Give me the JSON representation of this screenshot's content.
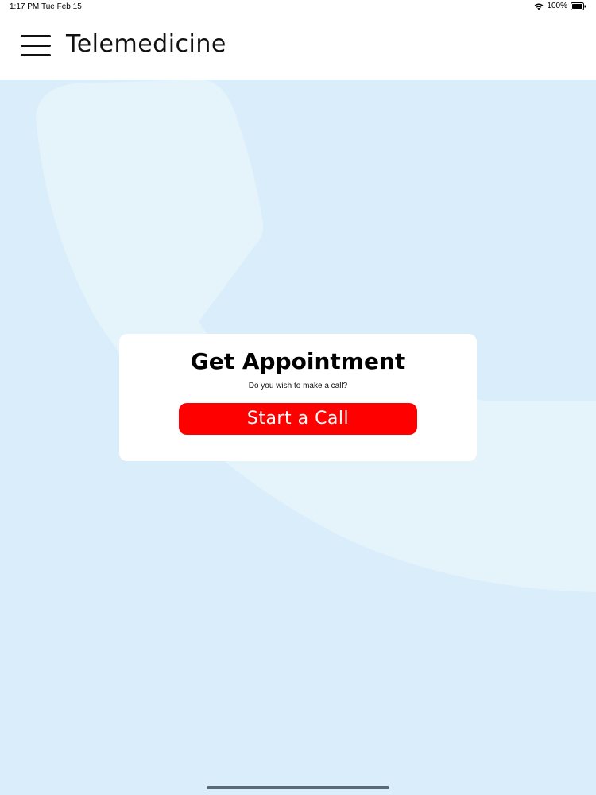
{
  "status_bar": {
    "time": "1:17 PM",
    "date": "Tue Feb 15",
    "battery": "100%",
    "wifi_icon": "wifi-icon",
    "battery_icon": "battery-full-icon"
  },
  "nav": {
    "title": "Telemedicine",
    "menu_icon": "hamburger-menu-icon"
  },
  "background": {
    "illustration": "phone-handset-watermark",
    "color": "#d9eefa"
  },
  "card": {
    "title": "Get Appointment",
    "subtitle": "Do you wish to make a call?",
    "button_label": "Start a Call",
    "button_color": "#ff0000"
  }
}
